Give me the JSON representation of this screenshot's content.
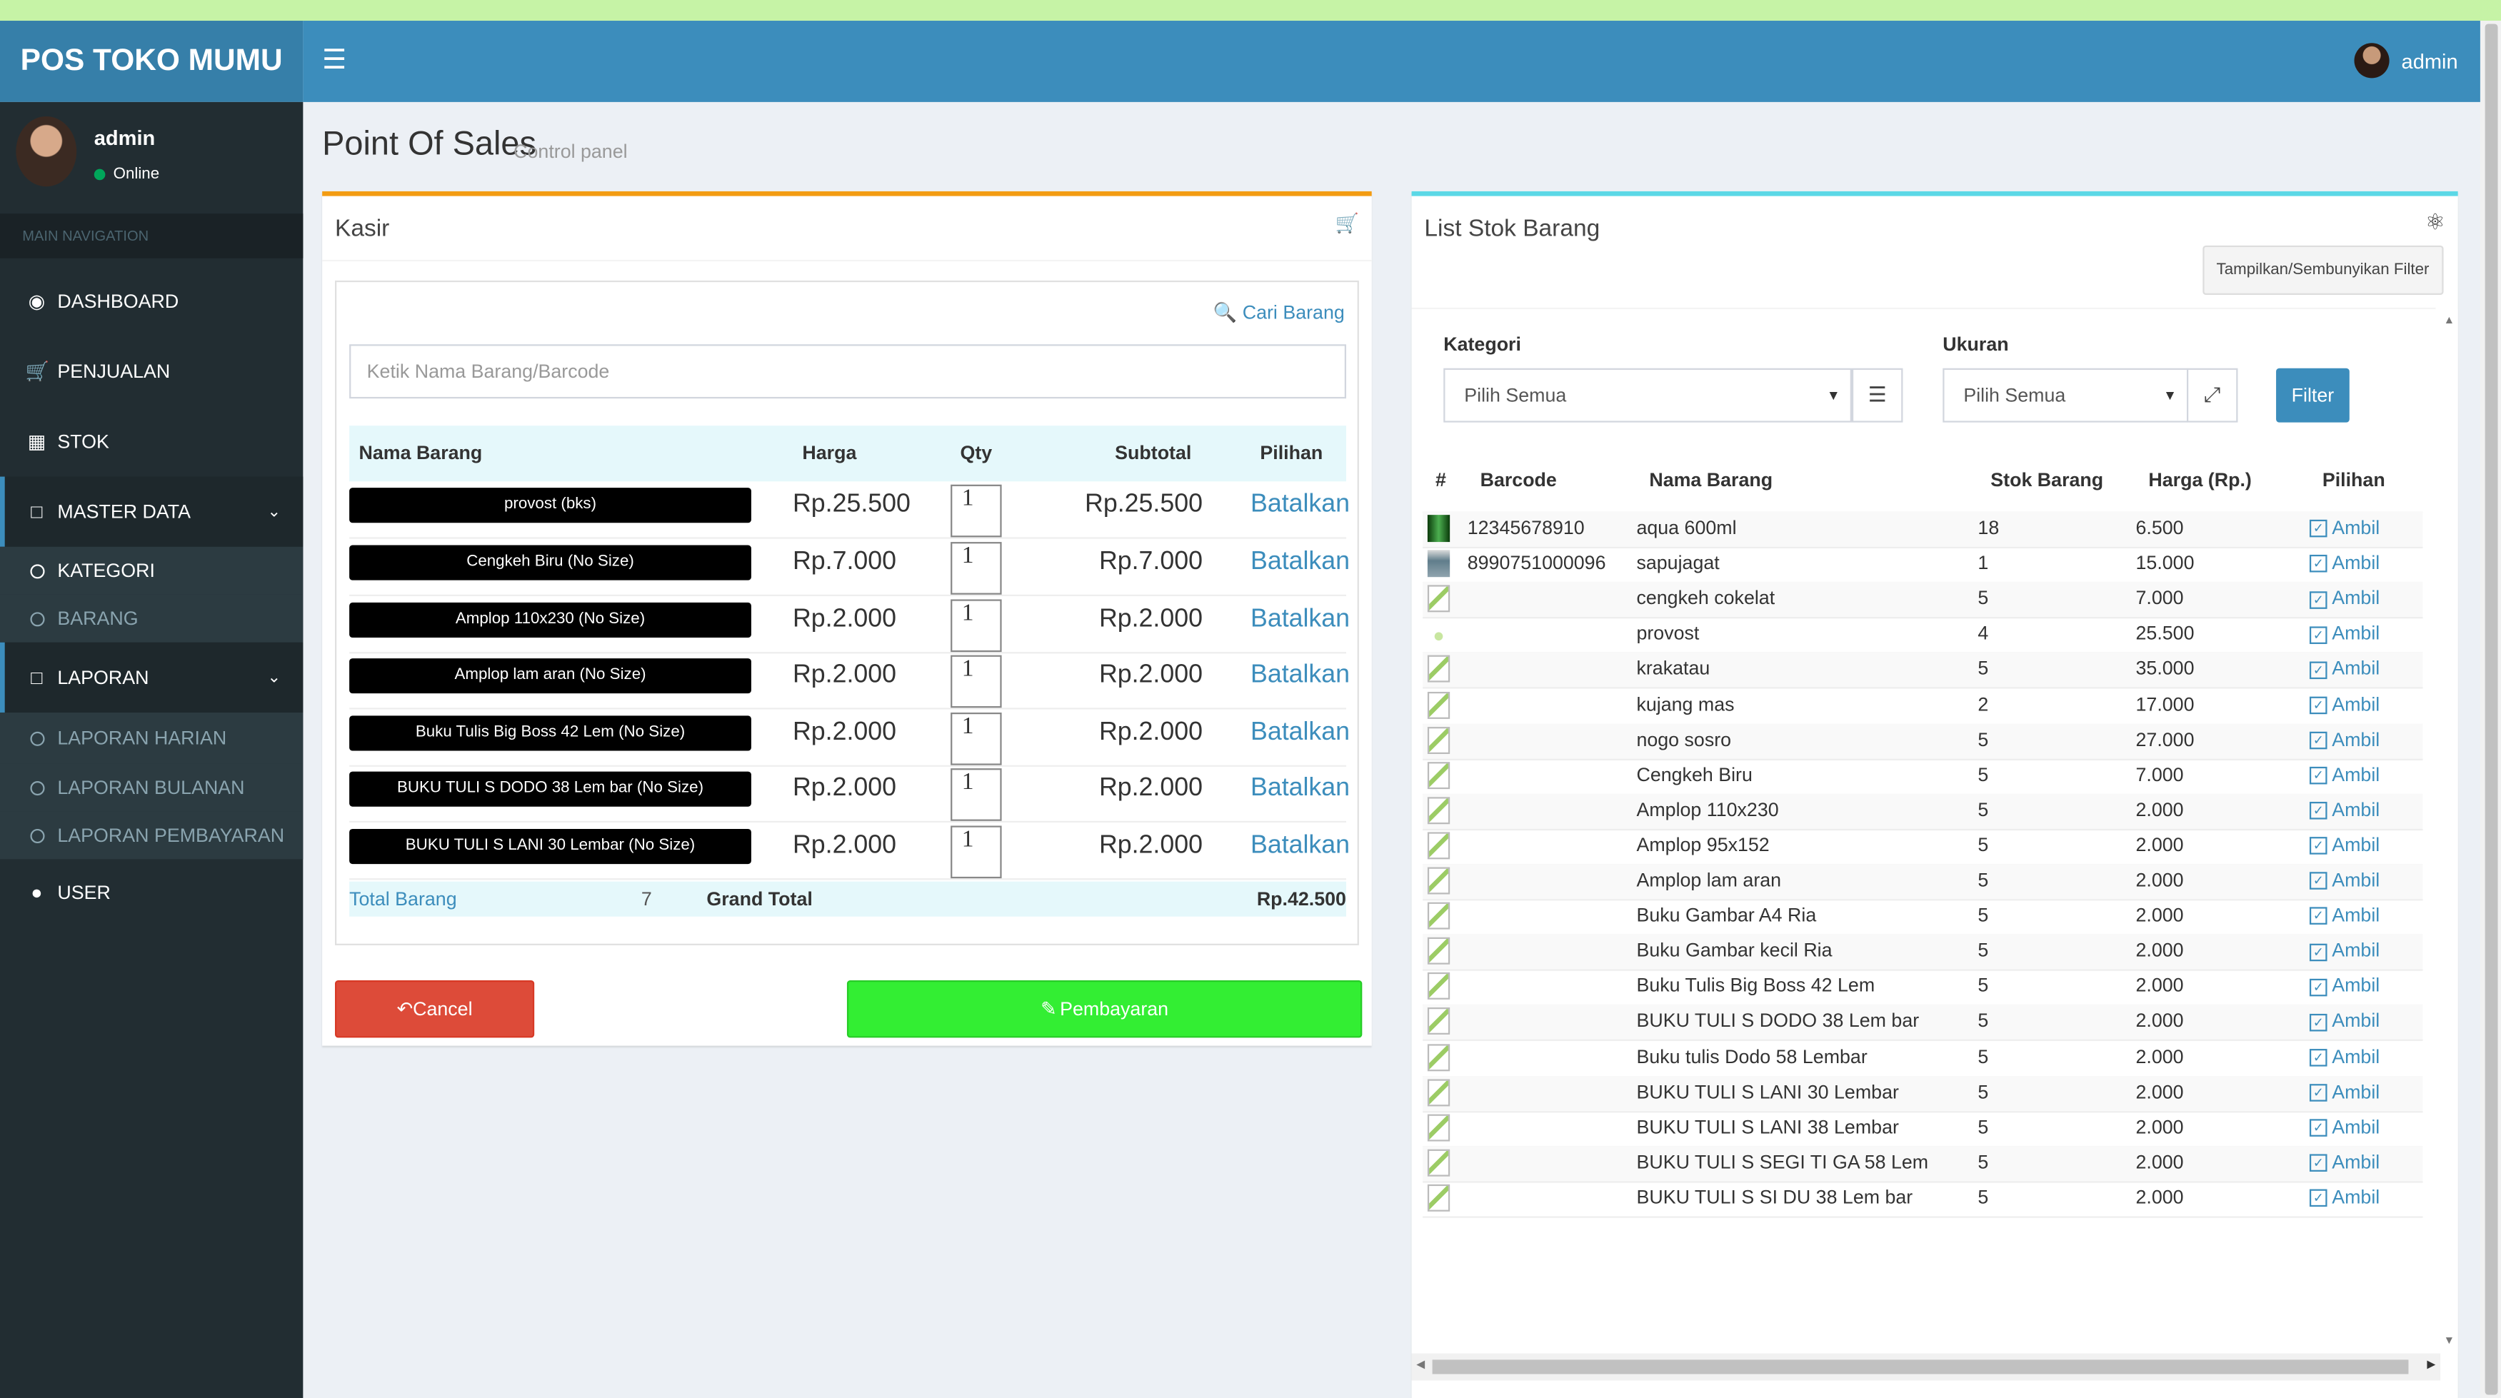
{
  "header": {
    "logo": "POS TOKO MUMU",
    "menu_icon": "hamburger-icon",
    "user_name": "admin"
  },
  "sidebar": {
    "user": {
      "name": "admin",
      "status": "Online"
    },
    "nav_header": "MAIN NAVIGATION",
    "items": [
      {
        "label": "DASHBOARD",
        "icon": "dashboard-icon"
      },
      {
        "label": "PENJUALAN",
        "icon": "cart-icon"
      },
      {
        "label": "STOK",
        "icon": "cubes-icon"
      },
      {
        "label": "MASTER DATA",
        "icon": "folder-icon",
        "sub": [
          {
            "label": "KATEGORI"
          },
          {
            "label": "BARANG"
          }
        ]
      },
      {
        "label": "LAPORAN",
        "icon": "folder-icon",
        "sub": [
          {
            "label": "LAPORAN HARIAN"
          },
          {
            "label": "LAPORAN BULANAN"
          },
          {
            "label": "LAPORAN PEMBAYARAN"
          }
        ]
      },
      {
        "label": "USER",
        "icon": "user-icon"
      }
    ]
  },
  "page": {
    "title": "Point Of Sales",
    "subtitle": "Control panel"
  },
  "kasir": {
    "title": "Kasir",
    "cari_barang": "Cari Barang",
    "search_placeholder": "Ketik Nama Barang/Barcode",
    "columns": {
      "name": "Nama Barang",
      "price": "Harga",
      "qty": "Qty",
      "subtotal": "Subtotal",
      "action": "Pilihan"
    },
    "rows": [
      {
        "name": "provost (bks)",
        "price": "Rp.25.500",
        "qty": "1",
        "subtotal": "Rp.25.500",
        "action": "Batalkan"
      },
      {
        "name": "Cengkeh Biru (No Size)",
        "price": "Rp.7.000",
        "qty": "1",
        "subtotal": "Rp.7.000",
        "action": "Batalkan"
      },
      {
        "name": "Amplop 110x230 (No Size)",
        "price": "Rp.2.000",
        "qty": "1",
        "subtotal": "Rp.2.000",
        "action": "Batalkan"
      },
      {
        "name": "Amplop lam aran (No Size)",
        "price": "Rp.2.000",
        "qty": "1",
        "subtotal": "Rp.2.000",
        "action": "Batalkan"
      },
      {
        "name": "Buku Tulis Big Boss 42 Lem (No Size)",
        "price": "Rp.2.000",
        "qty": "1",
        "subtotal": "Rp.2.000",
        "action": "Batalkan"
      },
      {
        "name": "BUKU TULI S DODO 38 Lem bar (No Size)",
        "price": "Rp.2.000",
        "qty": "1",
        "subtotal": "Rp.2.000",
        "action": "Batalkan"
      },
      {
        "name": "BUKU TULI S LANI 30 Lembar (No Size)",
        "price": "Rp.2.000",
        "qty": "1",
        "subtotal": "Rp.2.000",
        "action": "Batalkan"
      }
    ],
    "total_label": "Total Barang",
    "total_count": "7",
    "grand_total_label": "Grand Total",
    "grand_total": "Rp.42.500",
    "cancel_label": "Cancel",
    "pay_label": "Pembayaran"
  },
  "stok": {
    "title": "List Stok Barang",
    "toggle_filter": "Tampilkan/Sembunyikan Filter",
    "kategori_label": "Kategori",
    "kategori_value": "Pilih Semua",
    "ukuran_label": "Ukuran",
    "ukuran_value": "Pilih Semua",
    "filter_label": "Filter",
    "columns": {
      "no": "#",
      "barcode": "Barcode",
      "name": "Nama Barang",
      "stock": "Stok Barang",
      "price": "Harga (Rp.)",
      "action": "Pilihan"
    },
    "rows": [
      {
        "barcode": "12345678910",
        "name": "aqua 600ml",
        "stock": "18",
        "price": "6.500",
        "action": "Ambil"
      },
      {
        "barcode": "8990751000096",
        "name": "sapujagat",
        "stock": "1",
        "price": "15.000",
        "action": "Ambil"
      },
      {
        "barcode": "",
        "name": "cengkeh cokelat",
        "stock": "5",
        "price": "7.000",
        "action": "Ambil"
      },
      {
        "barcode": "",
        "name": "provost",
        "stock": "4",
        "price": "25.500",
        "action": "Ambil"
      },
      {
        "barcode": "",
        "name": "krakatau",
        "stock": "5",
        "price": "35.000",
        "action": "Ambil"
      },
      {
        "barcode": "",
        "name": "kujang mas",
        "stock": "2",
        "price": "17.000",
        "action": "Ambil"
      },
      {
        "barcode": "",
        "name": "nogo sosro",
        "stock": "5",
        "price": "27.000",
        "action": "Ambil"
      },
      {
        "barcode": "",
        "name": "Cengkeh Biru",
        "stock": "5",
        "price": "7.000",
        "action": "Ambil"
      },
      {
        "barcode": "",
        "name": "Amplop 110x230",
        "stock": "5",
        "price": "2.000",
        "action": "Ambil"
      },
      {
        "barcode": "",
        "name": "Amplop 95x152",
        "stock": "5",
        "price": "2.000",
        "action": "Ambil"
      },
      {
        "barcode": "",
        "name": "Amplop lam aran",
        "stock": "5",
        "price": "2.000",
        "action": "Ambil"
      },
      {
        "barcode": "",
        "name": "Buku Gambar A4 Ria",
        "stock": "5",
        "price": "2.000",
        "action": "Ambil"
      },
      {
        "barcode": "",
        "name": "Buku Gambar kecil Ria",
        "stock": "5",
        "price": "2.000",
        "action": "Ambil"
      },
      {
        "barcode": "",
        "name": "Buku Tulis Big Boss 42 Lem",
        "stock": "5",
        "price": "2.000",
        "action": "Ambil"
      },
      {
        "barcode": "",
        "name": "BUKU TULI S DODO 38 Lem bar",
        "stock": "5",
        "price": "2.000",
        "action": "Ambil"
      },
      {
        "barcode": "",
        "name": "Buku tulis Dodo 58 Lembar",
        "stock": "5",
        "price": "2.000",
        "action": "Ambil"
      },
      {
        "barcode": "",
        "name": "BUKU TULI S LANI 30 Lembar",
        "stock": "5",
        "price": "2.000",
        "action": "Ambil"
      },
      {
        "barcode": "",
        "name": "BUKU TULI S LANI 38 Lembar",
        "stock": "5",
        "price": "2.000",
        "action": "Ambil"
      },
      {
        "barcode": "",
        "name": "BUKU TULI S SEGI TI GA 58 Lem",
        "stock": "5",
        "price": "2.000",
        "action": "Ambil"
      },
      {
        "barcode": "",
        "name": "BUKU TULI S SI DU 38 Lem bar",
        "stock": "5",
        "price": "2.000",
        "action": "Ambil"
      }
    ]
  },
  "colors": {
    "header": "#3c8dbc",
    "logo_bg": "#367fa9",
    "sidebar": "#222d32",
    "kasir_accent": "#f39c12",
    "stok_accent": "#5bd8e6",
    "cancel": "#dd4b39",
    "pay": "#33ee33",
    "link": "#3c8dbc"
  }
}
